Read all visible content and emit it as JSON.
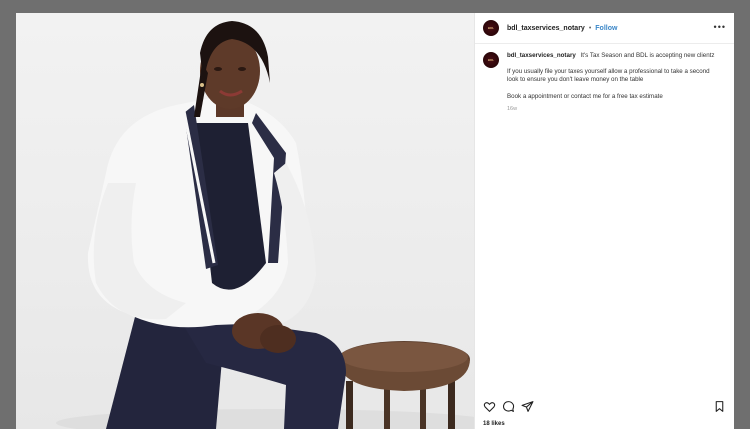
{
  "post": {
    "username": "bdl_taxservices_notary",
    "follow_label": "Follow",
    "separator": "•",
    "more_label": "•••",
    "avatar_text": "BDL",
    "caption_lead": "It's Tax Season and BDL is accepting new clientz",
    "caption_paragraphs": [
      "If you usually file your taxes yourself allow a professional to take a second look to ensure you don't leave money on the table",
      "Book a appointment or contact me for a free tax estimate"
    ],
    "time_ago": "16w",
    "likes": "18 likes"
  },
  "icons": {
    "like": "heart-icon",
    "comment": "comment-icon",
    "share": "share-icon",
    "save": "bookmark-icon"
  },
  "colors": {
    "backdrop": "#6f6f6f",
    "follow": "#3a86c8",
    "avatar": "#3a080d",
    "jacket": "#f7f7f7",
    "trim": "#2b2d45",
    "pants": "#23253d",
    "stool_seat": "#6b4a35"
  }
}
